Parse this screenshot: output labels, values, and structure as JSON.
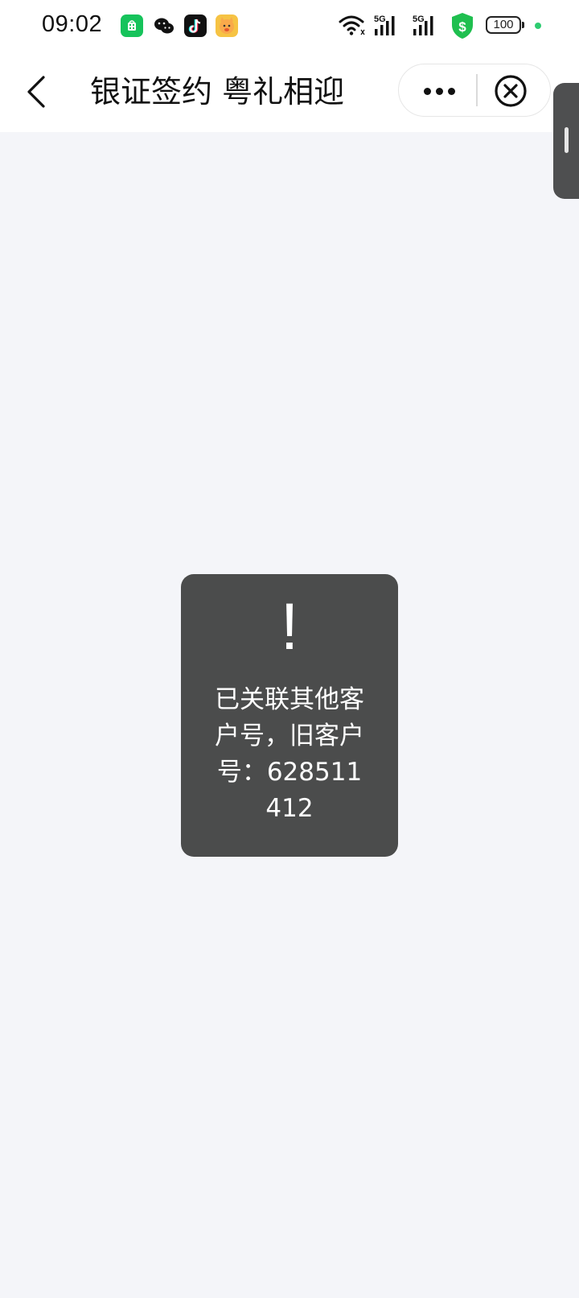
{
  "status_bar": {
    "time": "09:02",
    "battery": "100",
    "network_1": "5G",
    "network_2": "5G",
    "icons": [
      "app-store-icon",
      "wechat-icon",
      "tiktok-icon",
      "cat-app-icon",
      "wifi-icon",
      "signal-icon",
      "signal-icon",
      "security-shield-icon",
      "battery-icon"
    ],
    "dot_color": "#2ecc71"
  },
  "nav": {
    "title": "银证签约 粤礼相迎",
    "back_icon": "chevron-left-icon",
    "more_icon": "more-dots-icon",
    "close_icon": "close-circle-icon"
  },
  "toast": {
    "icon": "!",
    "message": "已关联其他客户号，旧客户号：628511412",
    "background": "#4b4c4c"
  },
  "colors": {
    "page_background": "#f4f5f9",
    "header_background": "#ffffff",
    "app_green": "#16c35b",
    "shield_green": "#1fbf4f"
  }
}
